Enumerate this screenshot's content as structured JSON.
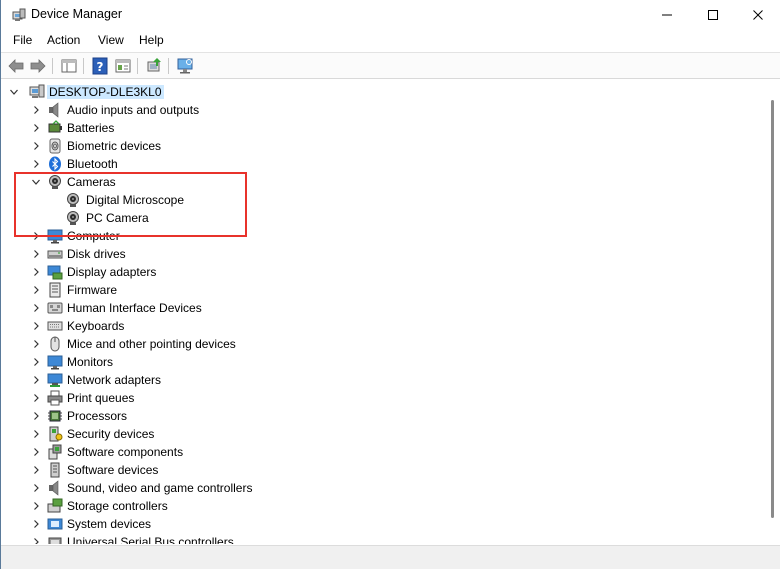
{
  "window": {
    "title": "Device Manager"
  },
  "titlebar": {
    "minimize_glyph": "—",
    "maximize_glyph": "☐",
    "close_glyph": "✕"
  },
  "menu": {
    "items": [
      "File",
      "Action",
      "View",
      "Help"
    ]
  },
  "toolbar": {
    "buttons": [
      "back-icon",
      "forward-icon",
      "show-hide-console-tree-icon",
      "help-icon",
      "properties-icon",
      "update-driver-icon",
      "scan-hardware-icon"
    ]
  },
  "tree": {
    "root": {
      "label": "DESKTOP-DLE3KL0",
      "expanded": true,
      "icon": "computer-icon"
    },
    "categories": [
      {
        "label": "Audio inputs and outputs",
        "icon": "speaker-icon",
        "expanded": false
      },
      {
        "label": "Batteries",
        "icon": "battery-icon",
        "expanded": false
      },
      {
        "label": "Biometric devices",
        "icon": "fingerprint-icon",
        "expanded": false
      },
      {
        "label": "Bluetooth",
        "icon": "bluetooth-icon",
        "expanded": false
      },
      {
        "label": "Cameras",
        "icon": "webcam-icon",
        "expanded": true,
        "children": [
          {
            "label": "Digital Microscope",
            "icon": "webcam-icon"
          },
          {
            "label": "PC Camera",
            "icon": "webcam-icon"
          }
        ]
      },
      {
        "label": "Computer",
        "icon": "monitor-icon",
        "expanded": false
      },
      {
        "label": "Disk drives",
        "icon": "disk-drive-icon",
        "expanded": false
      },
      {
        "label": "Display adapters",
        "icon": "display-adapter-icon",
        "expanded": false
      },
      {
        "label": "Firmware",
        "icon": "firmware-icon",
        "expanded": false
      },
      {
        "label": "Human Interface Devices",
        "icon": "hid-icon",
        "expanded": false
      },
      {
        "label": "Keyboards",
        "icon": "keyboard-icon",
        "expanded": false
      },
      {
        "label": "Mice and other pointing devices",
        "icon": "mouse-icon",
        "expanded": false
      },
      {
        "label": "Monitors",
        "icon": "monitor-icon",
        "expanded": false
      },
      {
        "label": "Network adapters",
        "icon": "network-adapter-icon",
        "expanded": false
      },
      {
        "label": "Print queues",
        "icon": "printer-icon",
        "expanded": false
      },
      {
        "label": "Processors",
        "icon": "processor-icon",
        "expanded": false
      },
      {
        "label": "Security devices",
        "icon": "security-device-icon",
        "expanded": false
      },
      {
        "label": "Software components",
        "icon": "software-component-icon",
        "expanded": false
      },
      {
        "label": "Software devices",
        "icon": "software-device-icon",
        "expanded": false
      },
      {
        "label": "Sound, video and game controllers",
        "icon": "sound-icon",
        "expanded": false
      },
      {
        "label": "Storage controllers",
        "icon": "storage-controller-icon",
        "expanded": false
      },
      {
        "label": "System devices",
        "icon": "system-device-icon",
        "expanded": false
      },
      {
        "label": "Universal Serial Bus controllers",
        "icon": "usb-icon",
        "expanded": false
      }
    ]
  },
  "annotation": {
    "highlight_color": "#e8322b"
  },
  "colors": {
    "selection": "#cce8ff",
    "scroll_thumb": "#8a8a8a"
  }
}
